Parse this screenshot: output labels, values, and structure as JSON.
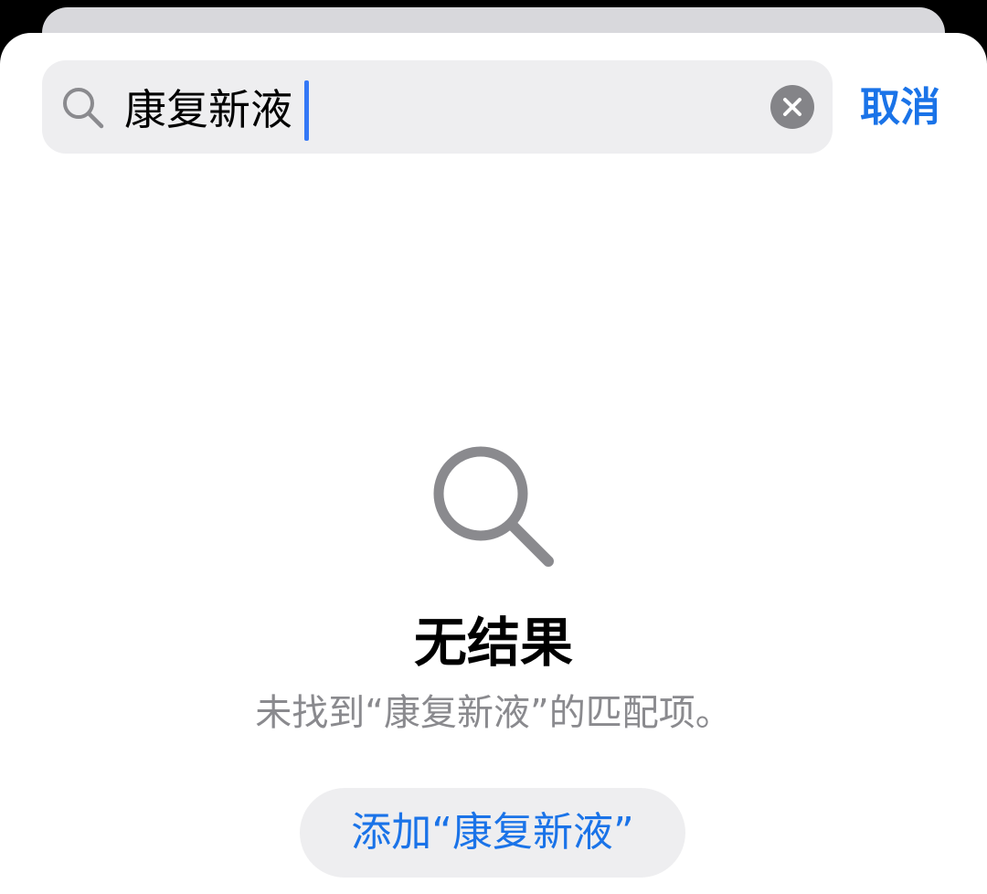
{
  "search": {
    "query": "康复新液",
    "clear_icon": "clear-icon",
    "search_icon": "search-icon"
  },
  "header": {
    "cancel_label": "取消"
  },
  "empty_state": {
    "icon": "search-icon",
    "title": "无结果",
    "subtitle": "未找到“康复新液”的匹配项。",
    "add_label": "添加“康复新液”"
  },
  "colors": {
    "accent": "#1a73e8",
    "caret": "#3478f6",
    "secondary_text": "#8a8a8e",
    "field_background": "#eeeef0"
  }
}
